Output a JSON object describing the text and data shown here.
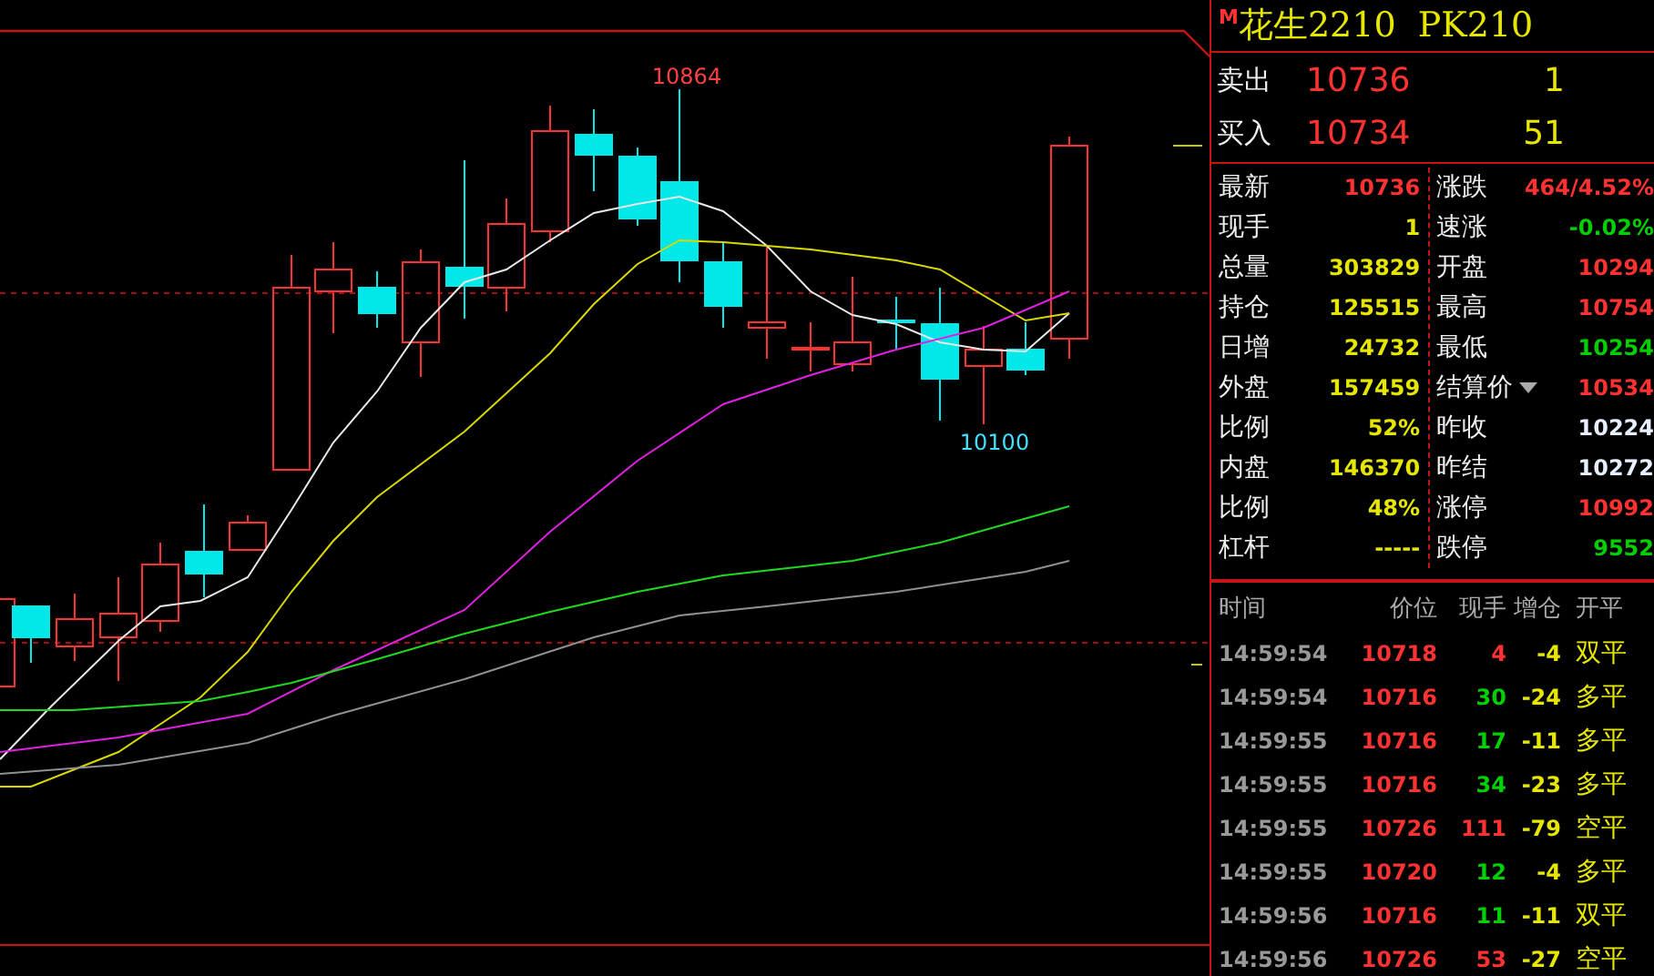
{
  "chart": {
    "high_label": "10864",
    "low_label": "10100"
  },
  "title": {
    "badge": "M",
    "text": "花生2210  PK210"
  },
  "quotes": [
    {
      "label": "卖出",
      "price": "10736",
      "volume": "1"
    },
    {
      "label": "买入",
      "price": "10734",
      "volume": "51"
    }
  ],
  "stats_left": [
    {
      "label": "最新",
      "value": "10736",
      "color": "#ff3232"
    },
    {
      "label": "现手",
      "value": "1",
      "color": "#e6e600"
    },
    {
      "label": "总量",
      "value": "303829",
      "color": "#e6e600"
    },
    {
      "label": "持仓",
      "value": "125515",
      "color": "#e6e600"
    },
    {
      "label": "日增",
      "value": "24732",
      "color": "#e6e600"
    },
    {
      "label": "外盘",
      "value": "157459",
      "color": "#e6e600"
    },
    {
      "label": "比例",
      "value": "52%",
      "color": "#e6e600"
    },
    {
      "label": "内盘",
      "value": "146370",
      "color": "#e6e600"
    },
    {
      "label": "比例",
      "value": "48%",
      "color": "#e6e600"
    },
    {
      "label": "杠杆",
      "value": "-----",
      "color": "#e6e600"
    }
  ],
  "stats_right": [
    {
      "label": "涨跌",
      "value": "464/4.52%",
      "color": "#ff3232",
      "kind": "plain"
    },
    {
      "label": "速涨",
      "value": "-0.02%",
      "color": "#00d000",
      "kind": "plain"
    },
    {
      "label": "开盘",
      "value": "10294",
      "color": "#ff3232",
      "kind": "plain"
    },
    {
      "label": "最高",
      "value": "10754",
      "color": "#ff3232",
      "kind": "plain"
    },
    {
      "label": "最低",
      "value": "10254",
      "color": "#00d000",
      "kind": "plain"
    },
    {
      "label": "结算价",
      "value": "10534",
      "color": "#ff3232",
      "kind": "dropdown"
    },
    {
      "label": "昨收",
      "value": "10224",
      "color": "#e8f0ff",
      "kind": "plain"
    },
    {
      "label": "昨结",
      "value": "10272",
      "color": "#e8f0ff",
      "kind": "plain"
    },
    {
      "label": "涨停",
      "value": "10992",
      "color": "#ff3232",
      "kind": "plain"
    },
    {
      "label": "跌停",
      "value": "9552",
      "color": "#00d000",
      "kind": "plain"
    }
  ],
  "trades": {
    "columns": [
      "时间",
      "价位",
      "现手",
      "增仓",
      "开平"
    ],
    "rows": [
      {
        "time": "14:59:54",
        "price": "10718",
        "volume": "4",
        "color": "#ff3232",
        "oi_change": "-4",
        "type": "双平"
      },
      {
        "time": "14:59:54",
        "price": "10716",
        "volume": "30",
        "color": "#00d000",
        "oi_change": "-24",
        "type": "多平"
      },
      {
        "time": "14:59:55",
        "price": "10716",
        "volume": "17",
        "color": "#00d000",
        "oi_change": "-11",
        "type": "多平"
      },
      {
        "time": "14:59:55",
        "price": "10716",
        "volume": "34",
        "color": "#00d000",
        "oi_change": "-23",
        "type": "多平"
      },
      {
        "time": "14:59:55",
        "price": "10726",
        "volume": "111",
        "color": "#ff3232",
        "oi_change": "-79",
        "type": "空平"
      },
      {
        "time": "14:59:55",
        "price": "10720",
        "volume": "12",
        "color": "#00d000",
        "oi_change": "-4",
        "type": "多平"
      },
      {
        "time": "14:59:56",
        "price": "10716",
        "volume": "11",
        "color": "#00d000",
        "oi_change": "-11",
        "type": "双平"
      },
      {
        "time": "14:59:56",
        "price": "10726",
        "volume": "53",
        "color": "#ff3232",
        "oi_change": "-27",
        "type": "空平"
      }
    ]
  }
}
